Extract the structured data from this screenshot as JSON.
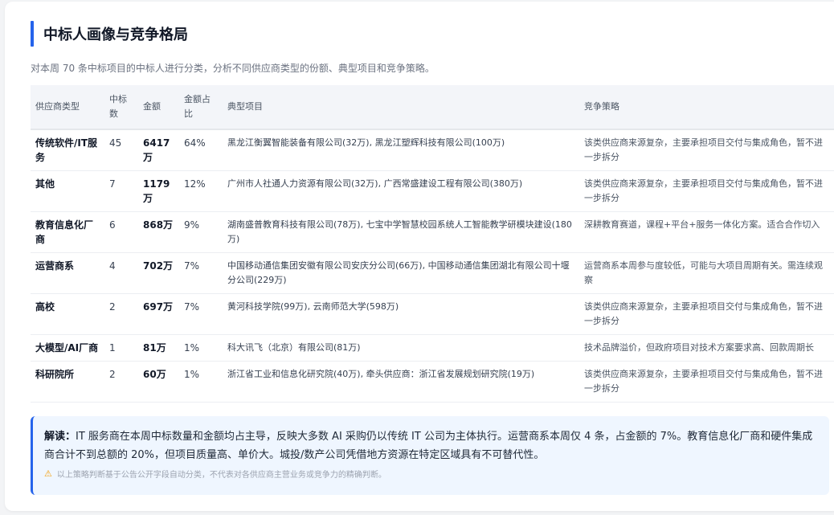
{
  "section": {
    "title": "中标人画像与竞争格局",
    "description": "对本周 70 条中标项目的中标人进行分类，分析不同供应商类型的份额、典型项目和竞争策略。"
  },
  "table": {
    "headers": {
      "type": "供应商类型",
      "count": "中标数",
      "amount": "金额",
      "share": "金额占比",
      "projects": "典型项目",
      "strategy": "竞争策略"
    },
    "rows": [
      {
        "type": "传统软件/IT服务",
        "count": "45",
        "amount": "6417万",
        "share": "64%",
        "projects": "黑龙江衡翼智能装备有限公司(32万), 黑龙江塑辉科技有限公司(100万)",
        "strategy": "该类供应商来源复杂，主要承担项目交付与集成角色，暂不进一步拆分"
      },
      {
        "type": "其他",
        "count": "7",
        "amount": "1179万",
        "share": "12%",
        "projects": "广州市人社通人力资源有限公司(32万), 广西常盛建设工程有限公司(380万)",
        "strategy": "该类供应商来源复杂，主要承担项目交付与集成角色，暂不进一步拆分"
      },
      {
        "type": "教育信息化厂商",
        "count": "6",
        "amount": "868万",
        "share": "9%",
        "projects": "湖南盛普教育科技有限公司(78万), 七宝中学智慧校园系统人工智能教学研模块建设(180万)",
        "strategy": "深耕教育赛道，课程+平台+服务一体化方案。适合合作切入"
      },
      {
        "type": "运营商系",
        "count": "4",
        "amount": "702万",
        "share": "7%",
        "projects": "中国移动通信集团安徽有限公司安庆分公司(66万), 中国移动通信集团湖北有限公司十堰分公司(229万)",
        "strategy": "运营商系本周参与度较低，可能与大项目周期有关。需连续观察"
      },
      {
        "type": "高校",
        "count": "2",
        "amount": "697万",
        "share": "7%",
        "projects": "黄河科技学院(99万), 云南师范大学(598万)",
        "strategy": "该类供应商来源复杂，主要承担项目交付与集成角色，暂不进一步拆分"
      },
      {
        "type": "大模型/AI厂商",
        "count": "1",
        "amount": "81万",
        "share": "1%",
        "projects": "科大讯飞（北京）有限公司(81万)",
        "strategy": "技术品牌溢价，但政府项目对技术方案要求高、回款周期长"
      },
      {
        "type": "科研院所",
        "count": "2",
        "amount": "60万",
        "share": "1%",
        "projects": "浙江省工业和信息化研究院(40万), 牵头供应商：浙江省发展规划研究院(19万)",
        "strategy": "该类供应商来源复杂，主要承担项目交付与集成角色，暂不进一步拆分"
      }
    ]
  },
  "note": {
    "label": "解读：",
    "text": "IT 服务商在本周中标数量和金额均占主导，反映大多数 AI 采购仍以传统 IT 公司为主体执行。运营商系本周仅 4 条，占金额的 7%。教育信息化厂商和硬件集成商合计不到总额的 20%，但项目质量高、单价大。城投/数产公司凭借地方资源在特定区域具有不可替代性。",
    "disclaimer": "以上策略判断基于公告公开字段自动分类，不代表对各供应商主营业务或竞争力的精确判断。",
    "icon": "warning-icon",
    "accent": "#2563eb"
  }
}
